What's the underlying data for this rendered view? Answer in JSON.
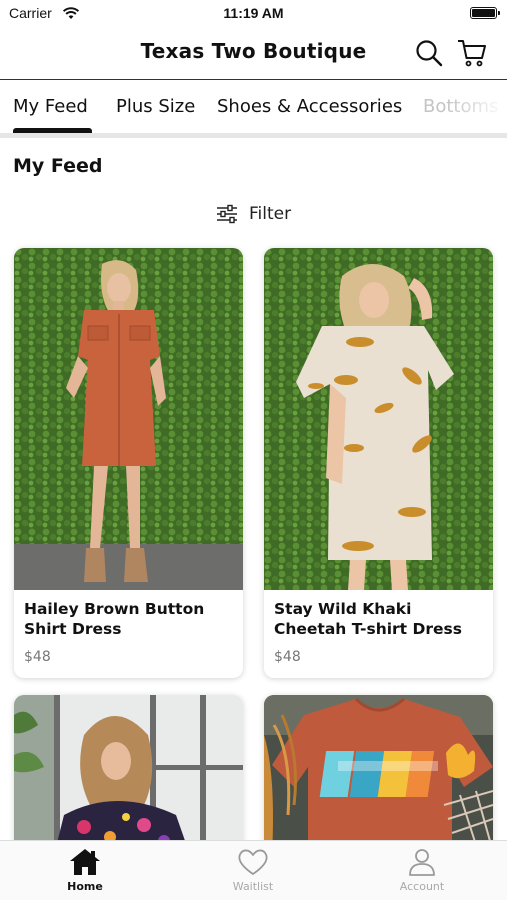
{
  "status_bar": {
    "carrier": "Carrier",
    "time": "11:19 AM"
  },
  "header": {
    "title": "Texas Two Boutique",
    "search_icon": "search-icon",
    "cart_icon": "cart-icon"
  },
  "tabs": [
    {
      "label": "My Feed",
      "active": true
    },
    {
      "label": "Plus Size"
    },
    {
      "label": "Shoes & Accessories"
    },
    {
      "label": "Bottoms"
    }
  ],
  "section": {
    "title": "My Feed"
  },
  "filter": {
    "label": "Filter",
    "icon": "sliders-icon"
  },
  "products": [
    {
      "name": "Hailey Brown Button Shirt Dress",
      "price": "$48"
    },
    {
      "name": "Stay Wild Khaki Cheetah T-shirt Dress",
      "price": "$48"
    },
    {
      "name": "",
      "price": ""
    },
    {
      "name": "",
      "price": ""
    }
  ],
  "tabbar": [
    {
      "label": "Home",
      "icon": "home-icon",
      "active": true
    },
    {
      "label": "Waitlist",
      "icon": "heart-icon"
    },
    {
      "label": "Account",
      "icon": "user-icon"
    }
  ],
  "colors": {
    "accent": "#111111",
    "muted": "#a9a9a9",
    "tab_inactive": "#c4c4c4"
  }
}
